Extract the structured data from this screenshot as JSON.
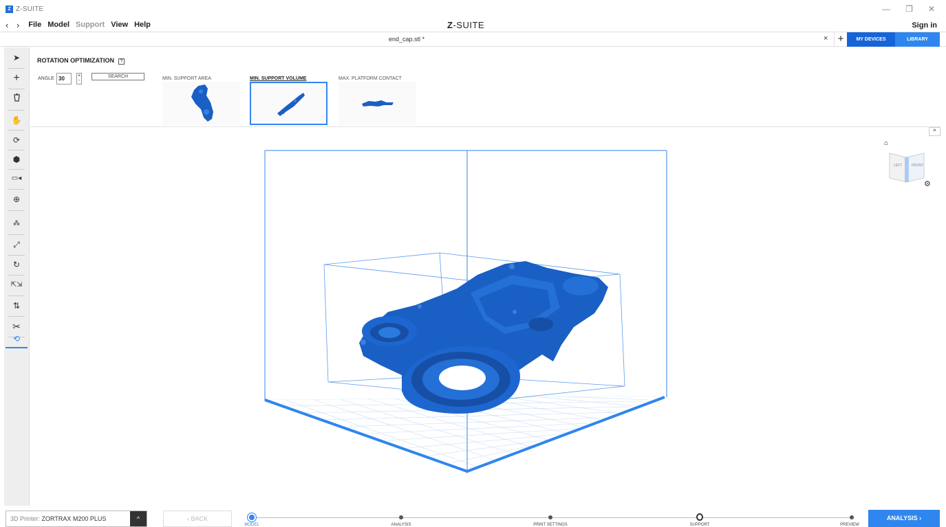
{
  "titlebar": {
    "app_name": "Z-SUITE",
    "badge": "Z"
  },
  "menubar": {
    "nav_arrows": "‹ ›",
    "items": [
      "File",
      "Model",
      "Support",
      "View",
      "Help"
    ],
    "brand_mark": "Z",
    "brand_rest": "-SUITE",
    "sign_in": "Sign in"
  },
  "tabbar": {
    "file_name": "end_cap.stl *",
    "close": "×",
    "add": "+",
    "my_devices": "MY DEVICES",
    "library": "LIBRARY"
  },
  "rotation": {
    "title": "ROTATION OPTIMIZATION",
    "help": "?",
    "angle_label": "ANGLE",
    "angle_value": "30",
    "search_label": "SEARCH",
    "options": [
      {
        "label": "MIN. SUPPORT AREA",
        "selected": false
      },
      {
        "label": "MIN. SUPPORT VOLUME",
        "selected": true
      },
      {
        "label": "MAX. PLATFORM CONTACT",
        "selected": false
      }
    ]
  },
  "viewcube": {
    "left": "LEFT",
    "front": "FRONT"
  },
  "bottom": {
    "printer_prefix": "3D Printer: ",
    "printer_name": "ZORTRAX M200 PLUS",
    "back": "‹  BACK",
    "steps": [
      "MODEL",
      "ANALYSIS",
      "PRINT SETTINGS",
      "SUPPORT",
      "PREVIEW"
    ],
    "current_step": "MODEL",
    "next": "ANALYSIS ›"
  },
  "colors": {
    "accent": "#2f86ee",
    "model": "#1a5fc4",
    "dark_blue": "#1565d8"
  },
  "icons": [
    "select-arrow-icon",
    "add-icon",
    "trash-icon",
    "hand-icon",
    "rotate-view-icon",
    "cube-icon",
    "camera-icon",
    "zoom-icon",
    "move-icon",
    "scale-icon",
    "rotate-icon",
    "mirror-icon",
    "auto-place-icon",
    "cut-icon",
    "rotation-optimization-icon"
  ]
}
